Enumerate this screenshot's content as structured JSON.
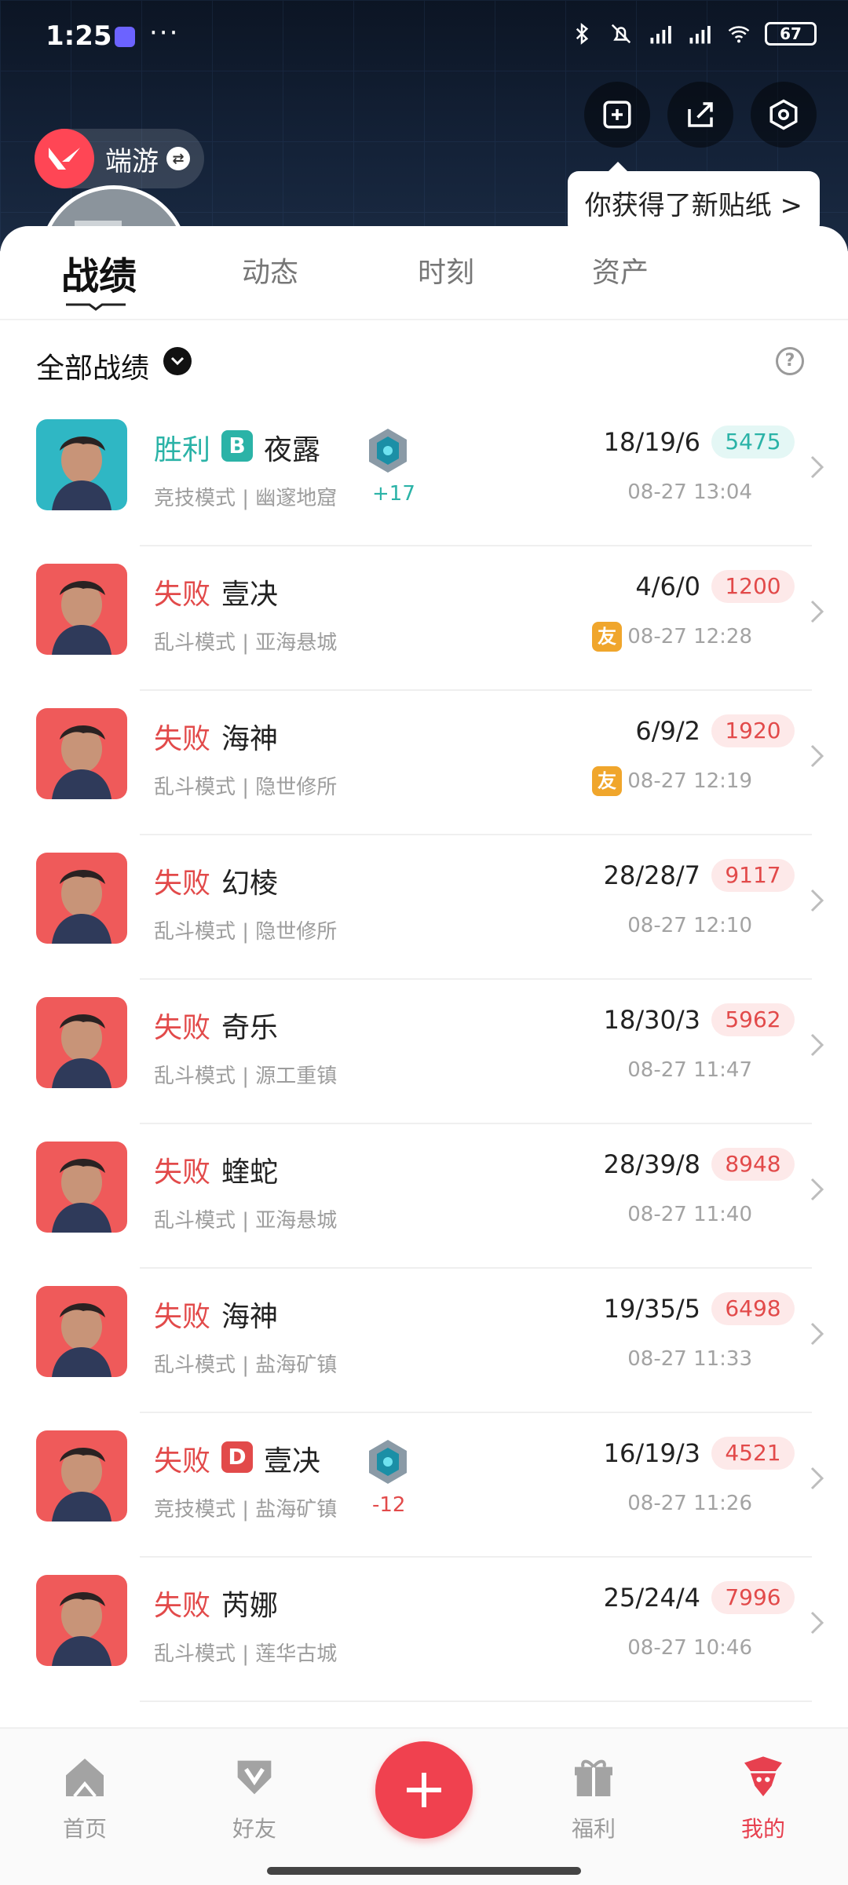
{
  "status_bar": {
    "time": "1:25",
    "battery": "67"
  },
  "header": {
    "game_name": "端游",
    "tooltip": "你获得了新贴纸 >"
  },
  "tabs": [
    {
      "label": "战绩"
    },
    {
      "label": "动态"
    },
    {
      "label": "时刻"
    },
    {
      "label": "资产"
    }
  ],
  "filter": {
    "label": "全部战绩",
    "help": "?"
  },
  "matches": [
    {
      "result": "胜利",
      "outcome": "win",
      "rank": "B",
      "agent": "夜露",
      "mode": "竞技模式 | 幽邃地窟",
      "rr": "+17",
      "kda": "18/19/6",
      "score": "5475",
      "datetime": "08-27 13:04",
      "agent_color": "#2fb7c4"
    },
    {
      "result": "失败",
      "outcome": "loss",
      "agent": "壹决",
      "mode": "乱斗模式 | 亚海悬城",
      "friend": "友",
      "kda": "4/6/0",
      "score": "1200",
      "datetime": "08-27 12:28",
      "agent_color": "#ef5a5a"
    },
    {
      "result": "失败",
      "outcome": "loss",
      "agent": "海神",
      "mode": "乱斗模式 | 隐世修所",
      "friend": "友",
      "kda": "6/9/2",
      "score": "1920",
      "datetime": "08-27 12:19",
      "agent_color": "#ef5a5a"
    },
    {
      "result": "失败",
      "outcome": "loss",
      "agent": "幻棱",
      "mode": "乱斗模式 | 隐世修所",
      "kda": "28/28/7",
      "score": "9117",
      "datetime": "08-27 12:10",
      "agent_color": "#ef5a5a"
    },
    {
      "result": "失败",
      "outcome": "loss",
      "agent": "奇乐",
      "mode": "乱斗模式 | 源工重镇",
      "kda": "18/30/3",
      "score": "5962",
      "datetime": "08-27 11:47",
      "agent_color": "#ef5a5a"
    },
    {
      "result": "失败",
      "outcome": "loss",
      "agent": "蝰蛇",
      "mode": "乱斗模式 | 亚海悬城",
      "kda": "28/39/8",
      "score": "8948",
      "datetime": "08-27 11:40",
      "agent_color": "#ef5a5a"
    },
    {
      "result": "失败",
      "outcome": "loss",
      "agent": "海神",
      "mode": "乱斗模式 | 盐海矿镇",
      "kda": "19/35/5",
      "score": "6498",
      "datetime": "08-27 11:33",
      "agent_color": "#ef5a5a"
    },
    {
      "result": "失败",
      "outcome": "loss",
      "rank": "D",
      "agent": "壹决",
      "mode": "竞技模式 | 盐海矿镇",
      "rr": "-12",
      "kda": "16/19/3",
      "score": "4521",
      "datetime": "08-27 11:26",
      "agent_color": "#ef5a5a"
    },
    {
      "result": "失败",
      "outcome": "loss",
      "agent": "芮娜",
      "mode": "乱斗模式 | 莲华古城",
      "kda": "25/24/4",
      "score": "7996",
      "datetime": "08-27 10:46",
      "agent_color": "#ef5a5a"
    }
  ],
  "bottom_nav": [
    {
      "label": "首页",
      "icon": "home-icon"
    },
    {
      "label": "好友",
      "icon": "friends-icon"
    },
    {
      "label": "",
      "icon": "plus-icon"
    },
    {
      "label": "福利",
      "icon": "gift-icon"
    },
    {
      "label": "我的",
      "icon": "profile-icon"
    }
  ],
  "colors": {
    "win": "#2bb3a7",
    "loss": "#e24a4a",
    "accent": "#f0414f",
    "friend_badge": "#f0a62c"
  }
}
